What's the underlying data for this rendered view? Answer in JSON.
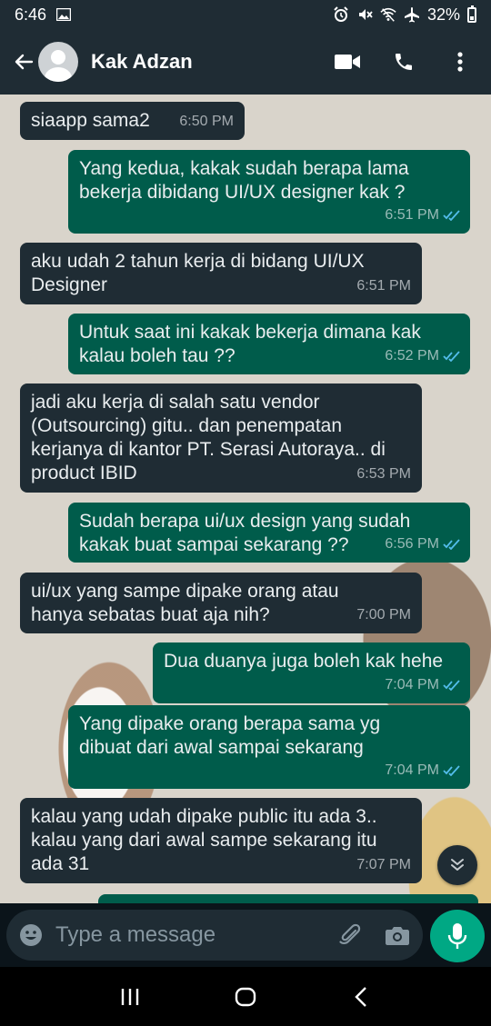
{
  "status_bar": {
    "time": "6:46",
    "battery": "32%"
  },
  "header": {
    "contact_name": "Kak Adzan"
  },
  "messages": [
    {
      "direction": "in",
      "text": "siaapp sama2",
      "time": "6:50 PM"
    },
    {
      "direction": "out",
      "text": "Yang kedua, kakak sudah berapa lama\nbekerja dibidang UI/UX designer kak ?",
      "time": "6:51 PM"
    },
    {
      "direction": "in",
      "text": "aku udah 2 tahun kerja di bidang UI/UX\nDesigner",
      "time": "6:51 PM"
    },
    {
      "direction": "out",
      "text": "Untuk saat ini kakak bekerja dimana kak\nkalau boleh tau ??",
      "time": "6:52 PM"
    },
    {
      "direction": "in",
      "text": "jadi aku kerja di salah satu vendor\n(Outsourcing) gitu.. dan penempatan\nkerjanya di kantor PT. Serasi Autoraya.. di\nproduct IBID",
      "time": "6:53 PM"
    },
    {
      "direction": "out",
      "text": "Sudah berapa ui/ux design yang sudah\nkakak buat sampai sekarang ??",
      "time": "6:56 PM"
    },
    {
      "direction": "in",
      "text": "ui/ux yang sampe dipake orang atau\nhanya sebatas buat aja nih?",
      "time": "7:00 PM"
    },
    {
      "direction": "out",
      "text": "Dua duanya juga boleh kak hehe",
      "time": "7:04 PM"
    },
    {
      "direction": "out",
      "text": "Yang dipake orang berapa sama yg\ndibuat dari awal sampai sekarang",
      "time": "7:04 PM"
    },
    {
      "direction": "in",
      "text": "kalau yang udah dipake public itu ada 3..\nkalau yang dari awal sampe sekarang itu\nada 31",
      "time": "7:07 PM"
    }
  ],
  "composer": {
    "placeholder": "Type a message"
  },
  "colors": {
    "incoming_bubble": "#1f2c34",
    "outgoing_bubble": "#005c4b",
    "accent": "#00a884",
    "read_ticks": "#53bdeb"
  }
}
